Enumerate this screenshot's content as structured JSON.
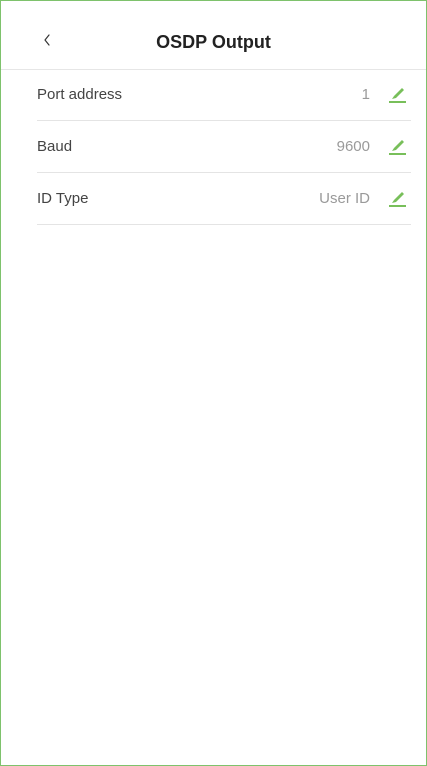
{
  "header": {
    "title": "OSDP Output",
    "back_icon": "chevron-left-icon"
  },
  "settings": [
    {
      "label": "Port address",
      "value": "1",
      "edit_icon": "pencil-icon"
    },
    {
      "label": "Baud",
      "value": "9600",
      "edit_icon": "pencil-icon"
    },
    {
      "label": "ID Type",
      "value": "User ID",
      "edit_icon": "pencil-icon"
    }
  ],
  "colors": {
    "accent": "#78bf5a",
    "frame_border": "#7ec26c",
    "title": "#222222",
    "label": "#444444",
    "value": "#9a9a9a",
    "divider": "#e4e4e4"
  }
}
